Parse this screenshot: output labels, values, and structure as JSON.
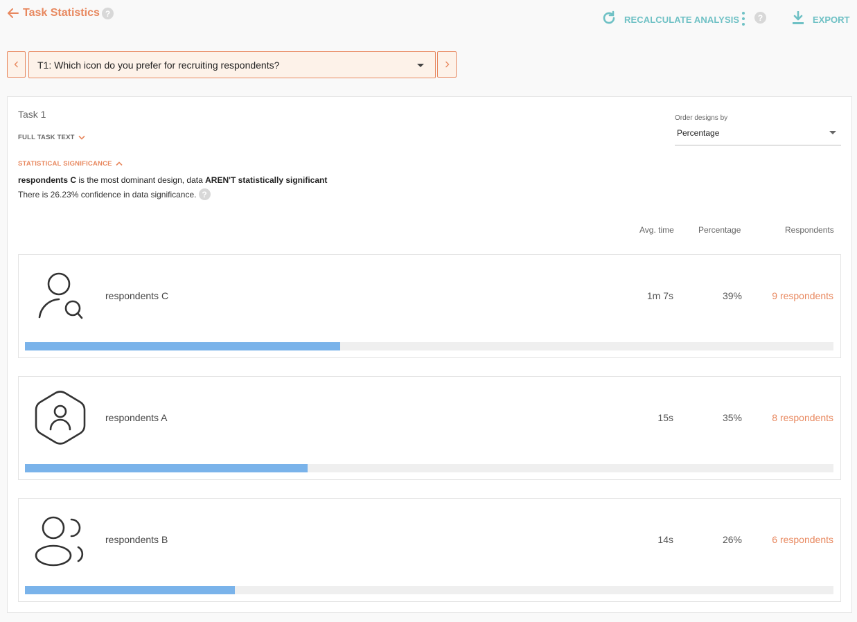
{
  "header": {
    "title": "Task Statistics",
    "help": "?",
    "recalculate_label": "RECALCULATE ANALYSIS",
    "export_label": "EXPORT"
  },
  "colors": {
    "accent": "#e8885f",
    "teal": "#6fc1c5",
    "bar": "#7ab3ea"
  },
  "task_selector": {
    "value": "T1: Which icon do you prefer for recruiting respondents?"
  },
  "task": {
    "label": "Task 1",
    "full_text_toggle": "FULL TASK TEXT",
    "significance_toggle": "STATISTICAL SIGNIFICANCE",
    "significance_design": "respondents C",
    "significance_mid": " is the most dominant design, data ",
    "significance_verdict": "AREN'T statistically significant",
    "confidence_text": "There is 26.23% confidence in data significance."
  },
  "order": {
    "label": "Order designs by",
    "value": "Percentage"
  },
  "columns": {
    "avg_time": "Avg. time",
    "percentage": "Percentage",
    "respondents": "Respondents"
  },
  "designs": [
    {
      "name": "respondents C",
      "icon": "person-search-icon",
      "avg_time": "1m 7s",
      "percentage": "39%",
      "respondents": "9 respondents",
      "fill": 0.39
    },
    {
      "name": "respondents A",
      "icon": "person-hexagon-icon",
      "avg_time": "15s",
      "percentage": "35%",
      "respondents": "8 respondents",
      "fill": 0.35
    },
    {
      "name": "respondents B",
      "icon": "people-group-icon",
      "avg_time": "14s",
      "percentage": "26%",
      "respondents": "6 respondents",
      "fill": 0.26
    }
  ]
}
